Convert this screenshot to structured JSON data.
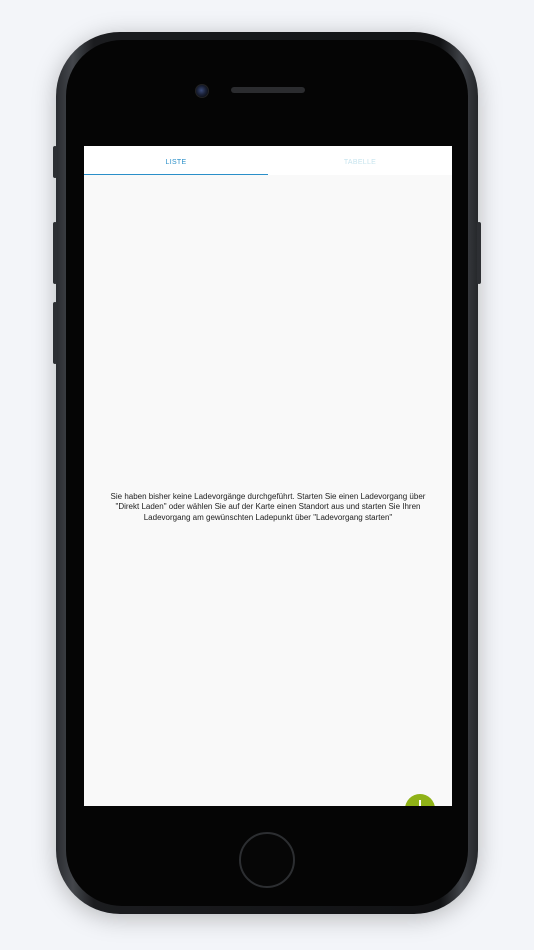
{
  "tabs": [
    {
      "label": "LISTE",
      "active": true
    },
    {
      "label": "TABELLE",
      "active": false
    }
  ],
  "empty_state": {
    "message": "Sie haben bisher keine Ladevorgänge durchgeführt. Starten Sie einen Ladevorgang über \"Direkt Laden\" oder wählen Sie auf der Karte einen Standort aus und starten Sie Ihren Ladevorgang am gewünschten Ladepunkt über \"Ladevorgang starten\""
  },
  "colors": {
    "accent": "#2a8fc9",
    "fab": "#8fb217",
    "inactive_tab": "#c7e4ee"
  },
  "icons": {
    "fab": "plus-icon"
  }
}
